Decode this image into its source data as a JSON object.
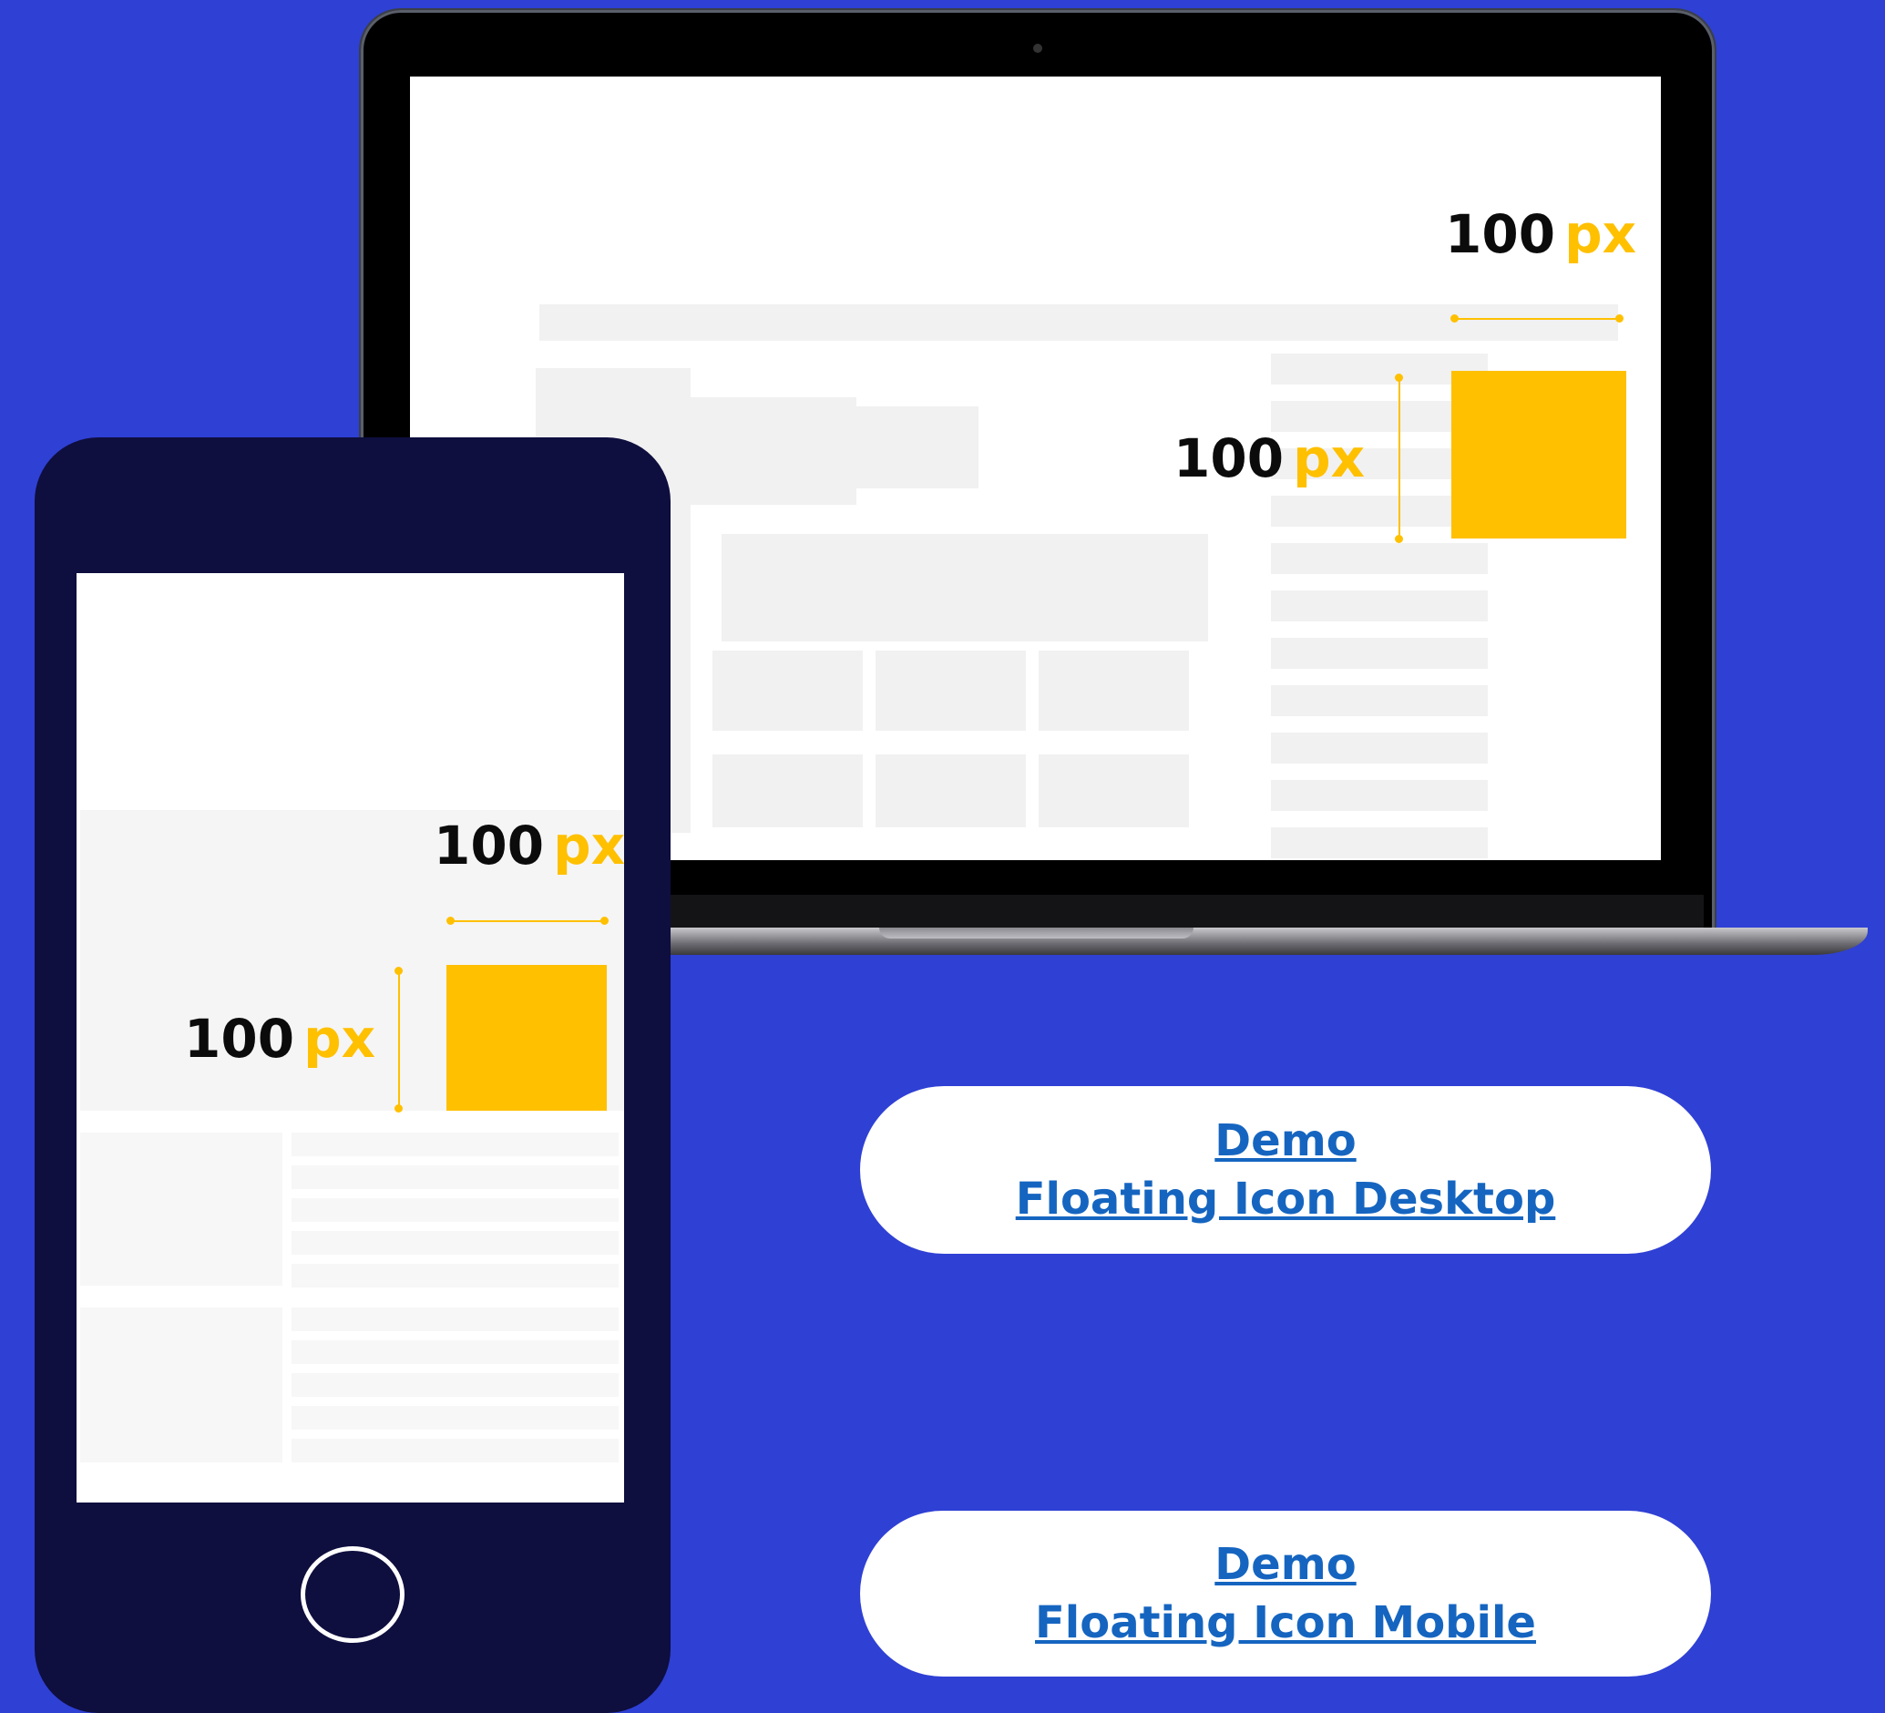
{
  "laptop": {
    "width_label": {
      "value": "100",
      "unit": "px"
    },
    "height_label": {
      "value": "100",
      "unit": "px"
    }
  },
  "phone": {
    "width_label": {
      "value": "100",
      "unit": "px"
    },
    "height_label": {
      "value": "100",
      "unit": "px"
    }
  },
  "buttons": {
    "desktop": {
      "line1": "Demo",
      "line2": "Floating Icon Desktop"
    },
    "mobile": {
      "line1": "Demo",
      "line2": "Floating Icon Mobile"
    }
  },
  "colors": {
    "background": "#2f40d4",
    "accent": "#ffc000",
    "link": "#1565c0",
    "phone_body": "#0e0e3f"
  }
}
